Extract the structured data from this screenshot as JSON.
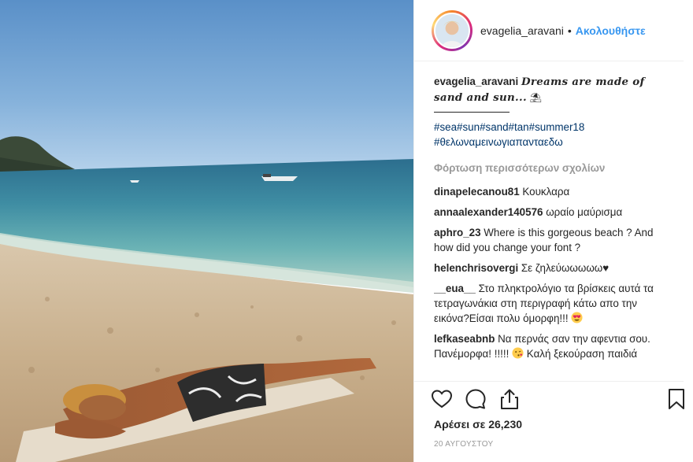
{
  "header": {
    "username": "evagelia_aravani",
    "separator": "•",
    "follow_label": "Ακολουθήστε"
  },
  "caption": {
    "username": "evagelia_aravani",
    "text": "Dreams are made of sand and sun...",
    "hashtags_line1": "#sea#sun#sand#tan#summer18",
    "hashtags_line2": "#θελωναμεινωγιαπανταεδω"
  },
  "load_more_label": "Φόρτωση περισσότερων σχολίων",
  "comments": [
    {
      "username": "dinapelecanou81",
      "text": "Κουκλαρα"
    },
    {
      "username": "annaalexander140576",
      "text": "ωραίο μαύρισμα"
    },
    {
      "username": "aphro_23",
      "text": "Where is this gorgeous beach ? And how did you change your font ?"
    },
    {
      "username": "helenchrisovergi",
      "text": "Σε ζηλεύωωωωω♥"
    },
    {
      "username": "__eua__",
      "text": "Στο πληκτρολόγιο τα βρίσκεις αυτά τα τετραγωνάκια στη περιγραφή κάτω απο την εικόνα?Είσαι πολυ όμορφη!!!"
    },
    {
      "username": "lefkaseabnb",
      "text": "Να περνάς σαν την αφεντια σου. Πανέμορφα! !!!!!",
      "text2": " Καλή ξεκούραση παιδιά"
    }
  ],
  "likes_text": "Αρέσει σε 26,230",
  "date_text": "20 ΑΥΓΟΥΣΤΟΥ",
  "icons": {
    "like": "heart-icon",
    "comment": "comment-bubble-icon",
    "share": "share-icon",
    "save": "bookmark-icon",
    "emoji_heart_eyes": "heart-eyes-emoji-icon",
    "emoji_kiss": "kissing-face-emoji-icon"
  },
  "colors": {
    "link": "#3897f0",
    "hashtag": "#003569",
    "muted": "#999999",
    "text": "#262626"
  }
}
